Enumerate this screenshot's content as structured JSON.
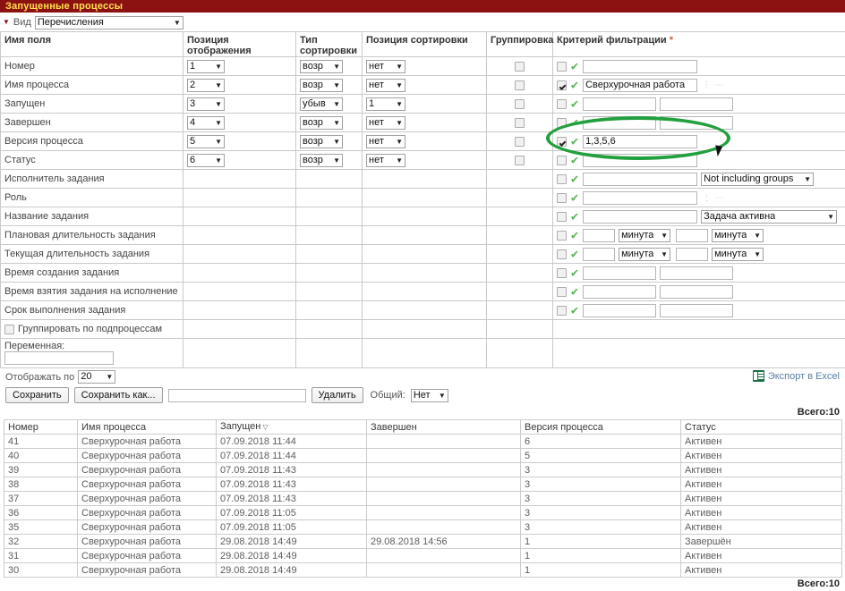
{
  "titlebar": {
    "title": "Запущенные процессы"
  },
  "viewbar": {
    "label": "Вид",
    "selected": "Перечисления",
    "caret": "▼"
  },
  "config": {
    "headers": {
      "field_name": "Имя поля",
      "display_position": "Позиция отображения",
      "sort_type": "Тип сортировки",
      "sort_position": "Позиция сортировки",
      "grouping": "Группировка",
      "filter_criterion": "Критерий фильтрации",
      "filter_required_mark": "*"
    },
    "rows": [
      {
        "name": "Номер",
        "pos": "1",
        "sort_type": "возр",
        "sort_pos": "нет",
        "group": false,
        "filter_enabled": false,
        "filter_value": "",
        "widget": "single"
      },
      {
        "name": "Имя процесса",
        "pos": "2",
        "sort_type": "возр",
        "sort_pos": "нет",
        "group": false,
        "filter_enabled": true,
        "filter_value": "Сверхурочная работа",
        "widget": "picker"
      },
      {
        "name": "Запущен",
        "pos": "3",
        "sort_type": "убыв",
        "sort_pos": "1",
        "group": false,
        "filter_enabled": false,
        "filter_value": "",
        "filter_value2": "",
        "widget": "range"
      },
      {
        "name": "Завершен",
        "pos": "4",
        "sort_type": "возр",
        "sort_pos": "нет",
        "group": false,
        "filter_enabled": false,
        "filter_value": "",
        "filter_value2": "",
        "widget": "range"
      },
      {
        "name": "Версия процесса",
        "pos": "5",
        "sort_type": "возр",
        "sort_pos": "нет",
        "group": false,
        "filter_enabled": true,
        "filter_value": "1,3,5,6",
        "widget": "single"
      },
      {
        "name": "Статус",
        "pos": "6",
        "sort_type": "возр",
        "sort_pos": "нет",
        "group": false,
        "filter_enabled": false,
        "filter_value": "",
        "widget": "single"
      },
      {
        "name": "Исполнитель задания",
        "pos": "",
        "sort_type": "",
        "sort_pos": "",
        "group": null,
        "filter_enabled": false,
        "filter_value": "",
        "widget": "select",
        "select_value": "Not including groups"
      },
      {
        "name": "Роль",
        "pos": "",
        "sort_type": "",
        "sort_pos": "",
        "group": null,
        "filter_enabled": false,
        "filter_value": "",
        "widget": "picker"
      },
      {
        "name": "Название задания",
        "pos": "",
        "sort_type": "",
        "sort_pos": "",
        "group": null,
        "filter_enabled": false,
        "filter_value": "",
        "widget": "select-wide",
        "select_value": "Задача активна"
      },
      {
        "name": "Плановая длительность задания",
        "pos": "",
        "sort_type": "",
        "sort_pos": "",
        "group": null,
        "filter_enabled": false,
        "filter_value": "",
        "filter_value2": "",
        "widget": "duration",
        "unit1": "минута",
        "unit2": "минута"
      },
      {
        "name": "Текущая длительность задания",
        "pos": "",
        "sort_type": "",
        "sort_pos": "",
        "group": null,
        "filter_enabled": false,
        "filter_value": "",
        "filter_value2": "",
        "widget": "duration",
        "unit1": "минута",
        "unit2": "минута"
      },
      {
        "name": "Время создания задания",
        "pos": "",
        "sort_type": "",
        "sort_pos": "",
        "group": null,
        "filter_enabled": false,
        "filter_value": "",
        "filter_value2": "",
        "widget": "range"
      },
      {
        "name": "Время взятия задания на исполнение",
        "pos": "",
        "sort_type": "",
        "sort_pos": "",
        "group": null,
        "filter_enabled": false,
        "filter_value": "",
        "filter_value2": "",
        "widget": "range"
      },
      {
        "name": "Срок выполнения задания",
        "pos": "",
        "sort_type": "",
        "sort_pos": "",
        "group": null,
        "filter_enabled": false,
        "filter_value": "",
        "filter_value2": "",
        "widget": "range"
      }
    ],
    "group_subprocess": {
      "label": "Группировать по подпроцессам",
      "checked": false
    },
    "variable": {
      "label": "Переменная:",
      "value": ""
    }
  },
  "toolbar": {
    "show_by_label": "Отображать по",
    "show_by_value": "20",
    "save_label": "Сохранить",
    "save_as_label": "Сохранить как...",
    "name_value": "",
    "delete_label": "Удалить",
    "shared_label": "Общий:",
    "shared_value": "Нет",
    "export_label": "Экспорт в Excel",
    "export_icon": "excel-icon"
  },
  "totals": {
    "top": "Всего:10",
    "bottom": "Всего:10"
  },
  "results": {
    "columns": [
      "Номер",
      "Имя процесса",
      "Запущен",
      "Завершен",
      "Версия процесса",
      "Статус"
    ],
    "sorted_column_index": 2,
    "sort_indicator": "▽",
    "rows": [
      [
        "41",
        "Сверхурочная работа",
        "07.09.2018 11:44",
        "",
        "6",
        "Активен"
      ],
      [
        "40",
        "Сверхурочная работа",
        "07.09.2018 11:44",
        "",
        "5",
        "Активен"
      ],
      [
        "39",
        "Сверхурочная работа",
        "07.09.2018 11:43",
        "",
        "3",
        "Активен"
      ],
      [
        "38",
        "Сверхурочная работа",
        "07.09.2018 11:43",
        "",
        "3",
        "Активен"
      ],
      [
        "37",
        "Сверхурочная работа",
        "07.09.2018 11:43",
        "",
        "3",
        "Активен"
      ],
      [
        "36",
        "Сверхурочная работа",
        "07.09.2018 11:05",
        "",
        "3",
        "Активен"
      ],
      [
        "35",
        "Сверхурочная работа",
        "07.09.2018 11:05",
        "",
        "3",
        "Активен"
      ],
      [
        "32",
        "Сверхурочная работа",
        "29.08.2018 14:49",
        "29.08.2018 14:56",
        "1",
        "Завершён"
      ],
      [
        "31",
        "Сверхурочная работа",
        "29.08.2018 14:49",
        "",
        "1",
        "Активен"
      ],
      [
        "30",
        "Сверхурочная работа",
        "29.08.2018 14:49",
        "",
        "1",
        "Активен"
      ]
    ]
  },
  "annotation": {
    "shape": "ellipse-highlight",
    "color": "#22a03e",
    "target": "Версия процесса filter"
  }
}
